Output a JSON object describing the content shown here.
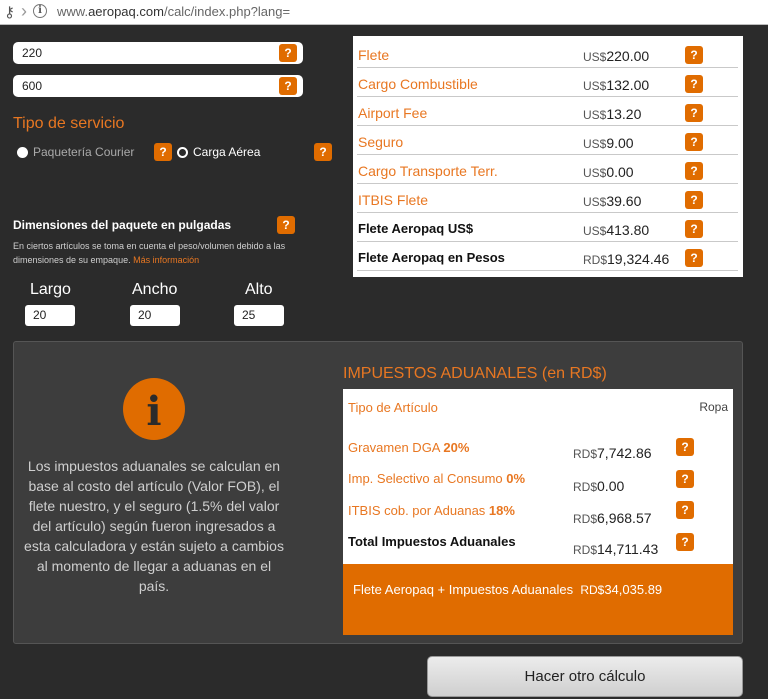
{
  "browser": {
    "url_prefix": "www.",
    "url_domain": "aeropaq.com",
    "url_path": "/calc/index.php?lang="
  },
  "inputs": {
    "value_1": "220",
    "value_2": "600"
  },
  "help_label": "?",
  "service": {
    "title": "Tipo de servicio",
    "option_courier": "Paquetería Courier",
    "option_air": "Carga Aérea",
    "selected": "Carga Aérea"
  },
  "dimensions": {
    "title": "Dimensiones del paquete en pulgadas",
    "note": "En ciertos artículos se toma en cuenta el peso/volumen debido a las dimensiones de su empaque.",
    "more_link": "Más información",
    "largo_label": "Largo",
    "ancho_label": "Ancho",
    "alto_label": "Alto",
    "largo": "20",
    "ancho": "20",
    "alto": "25"
  },
  "results": {
    "rows": [
      {
        "label": "Flete",
        "currency": "US$",
        "amount": "220.00"
      },
      {
        "label": "Cargo Combustible",
        "currency": "US$",
        "amount": "132.00"
      },
      {
        "label": "Airport Fee",
        "currency": "US$",
        "amount": "13.20"
      },
      {
        "label": "Seguro",
        "currency": "US$",
        "amount": "9.00"
      },
      {
        "label": "Cargo Transporte Terr.",
        "currency": "US$",
        "amount": "0.00"
      },
      {
        "label": "ITBIS Flete",
        "currency": "US$",
        "amount": "39.60"
      },
      {
        "label": "Flete Aeropaq US$",
        "currency": "US$",
        "amount": "413.80"
      },
      {
        "label": "Flete Aeropaq en Pesos",
        "currency": "RD$",
        "amount": "19,324.46"
      }
    ]
  },
  "taxes": {
    "info_text": "Los impuestos aduanales se calculan en base al costo del artículo (Valor FOB), el flete nuestro, y el seguro (1.5% del valor del artículo) según fueron ingresados a esta calculadora y están sujeto a cambios al momento de llegar a aduanas en el país.",
    "title": "IMPUESTOS ADUANALES (en RD$)",
    "article_type_label": "Tipo de Artículo",
    "article_type_value": "Ropa",
    "gravamen_label": "Gravamen DGA ",
    "gravamen_pct": "20%",
    "gravamen_currency": "RD$",
    "gravamen_amount": "7,742.86",
    "selectivo_label": "Imp. Selectivo al Consumo ",
    "selectivo_pct": "0%",
    "selectivo_currency": "RD$",
    "selectivo_amount": "0.00",
    "itbis_label": "ITBIS cob. por Aduanas ",
    "itbis_pct": "18%",
    "itbis_currency": "RD$",
    "itbis_amount": "6,968.57",
    "total_label": "Total Impuestos Aduanales",
    "total_currency": "RD$",
    "total_amount": "14,711.43",
    "grand_label": "Flete Aeropaq + Impuestos Aduanales",
    "grand_currency": "RD$",
    "grand_amount": "34,035.89"
  },
  "actions": {
    "again_label": "Hacer otro cálculo"
  },
  "colors": {
    "accent": "#e06c00",
    "accent_text": "#e87722",
    "background": "#2b2b2b",
    "panel": "#3d3d3d"
  }
}
